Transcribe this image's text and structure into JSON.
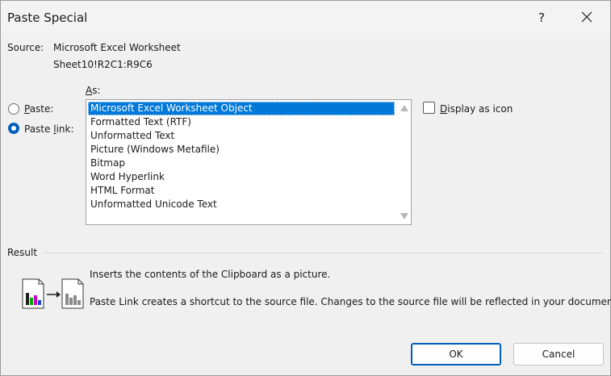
{
  "window": {
    "title": "Paste Special",
    "help_label": "?"
  },
  "source": {
    "label": "Source:",
    "app": "Microsoft Excel Worksheet",
    "range": "Sheet10!R2C1:R9C6"
  },
  "options": {
    "as_label_underlined": "A",
    "as_label_rest": "s:",
    "paste_underlined": "P",
    "paste_rest": "aste:",
    "paste_link_pre": "Paste ",
    "paste_link_underlined": "l",
    "paste_link_rest": "ink:",
    "selected_mode": "Paste link"
  },
  "formats": {
    "items": [
      "Microsoft Excel Worksheet Object",
      "Formatted Text (RTF)",
      "Unformatted Text",
      "Picture (Windows Metafile)",
      "Bitmap",
      "Word Hyperlink",
      "HTML Format",
      "Unformatted Unicode Text"
    ],
    "selected_index": 0
  },
  "display_icon": {
    "underlined": "D",
    "rest": "isplay as icon",
    "checked": false
  },
  "result": {
    "label": "Result",
    "line1": "Inserts the contents of the Clipboard as a picture.",
    "line2": "Paste Link creates a shortcut to the source file. Changes to the source file will be reflected in your document."
  },
  "buttons": {
    "ok": "OK",
    "cancel": "Cancel"
  },
  "colors": {
    "accent": "#005fb8",
    "selection": "#0078d7"
  }
}
